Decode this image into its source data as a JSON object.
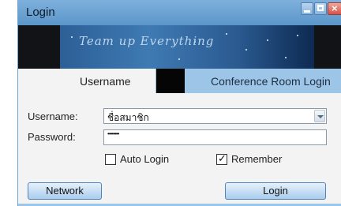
{
  "window": {
    "title": "Login",
    "controls": {
      "minimize": "minimize",
      "maximize": "maximize",
      "close": "close"
    },
    "close_glyph": "×"
  },
  "banner": {
    "text": "Team up Everything"
  },
  "tabs": [
    {
      "label": "Username",
      "active": true
    },
    {
      "label": "Conference Room Login",
      "active": false
    }
  ],
  "form": {
    "username_label": "Username:",
    "username_value": "ชื่อสมาชิก",
    "password_label": "Password:",
    "password_value": "••••••••",
    "auto_login_label": "Auto Login",
    "auto_login_checked": false,
    "remember_label": "Remember",
    "remember_checked": true,
    "remember_mark": "✓"
  },
  "buttons": {
    "network": "Network",
    "login": "Login"
  },
  "colors": {
    "titlebar": "#6fa4d3",
    "tab_strip": "#9dc5e8",
    "button_border": "#4d84b9",
    "window_bg": "#f3f3f3"
  }
}
